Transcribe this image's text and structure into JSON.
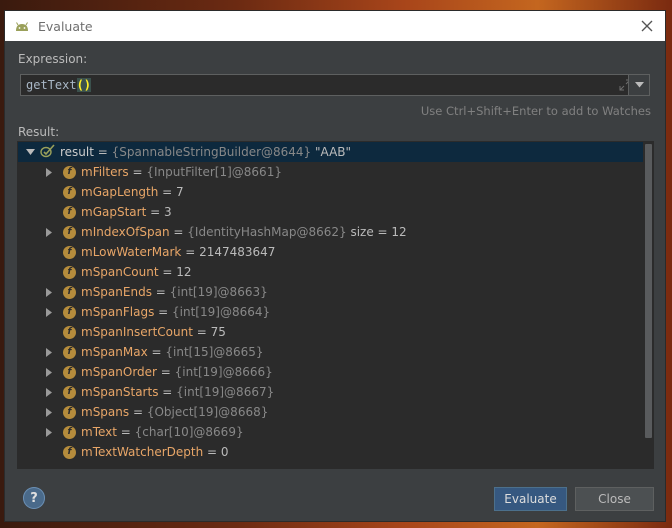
{
  "window": {
    "title": "Evaluate"
  },
  "expression": {
    "label_prefix": "Expression:",
    "code_name": "getText",
    "code_parens": "()",
    "hint": "Use Ctrl+Shift+Enter to add to Watches"
  },
  "result": {
    "label": "Result:",
    "root": {
      "name": "result",
      "eq": " = ",
      "ref": "{SpannableStringBuilder@8644}",
      "value": " \"AAB\""
    },
    "fields": [
      {
        "name": "mFilters",
        "ref": "{InputFilter[1]@8661}",
        "value": "",
        "expandable": true
      },
      {
        "name": "mGapLength",
        "ref": "",
        "value": "7",
        "expandable": false
      },
      {
        "name": "mGapStart",
        "ref": "",
        "value": "3",
        "expandable": false
      },
      {
        "name": "mIndexOfSpan",
        "ref": "{IdentityHashMap@8662}",
        "value": " size = 12",
        "expandable": true
      },
      {
        "name": "mLowWaterMark",
        "ref": "",
        "value": "2147483647",
        "expandable": false
      },
      {
        "name": "mSpanCount",
        "ref": "",
        "value": "12",
        "expandable": false
      },
      {
        "name": "mSpanEnds",
        "ref": "{int[19]@8663}",
        "value": "",
        "expandable": true
      },
      {
        "name": "mSpanFlags",
        "ref": "{int[19]@8664}",
        "value": "",
        "expandable": true
      },
      {
        "name": "mSpanInsertCount",
        "ref": "",
        "value": "75",
        "expandable": false
      },
      {
        "name": "mSpanMax",
        "ref": "{int[15]@8665}",
        "value": "",
        "expandable": true
      },
      {
        "name": "mSpanOrder",
        "ref": "{int[19]@8666}",
        "value": "",
        "expandable": true
      },
      {
        "name": "mSpanStarts",
        "ref": "{int[19]@8667}",
        "value": "",
        "expandable": true
      },
      {
        "name": "mSpans",
        "ref": "{Object[19]@8668}",
        "value": "",
        "expandable": true
      },
      {
        "name": "mText",
        "ref": "{char[10]@8669}",
        "value": "",
        "expandable": true
      },
      {
        "name": "mTextWatcherDepth",
        "ref": "",
        "value": "0",
        "expandable": false
      }
    ]
  },
  "buttons": {
    "help": "?",
    "evaluate": "Evaluate",
    "close": "Close"
  },
  "colors": {
    "accent": "#365880",
    "field_name": "#e8a668",
    "selection": "#0d293e",
    "field_icon": "#b58c3c"
  },
  "icons": {
    "app": "android-icon",
    "close": "close-icon",
    "expand": "expand-icon",
    "dropdown": "chevron-down-icon",
    "field": "field-icon",
    "watch": "watch-result-icon"
  }
}
